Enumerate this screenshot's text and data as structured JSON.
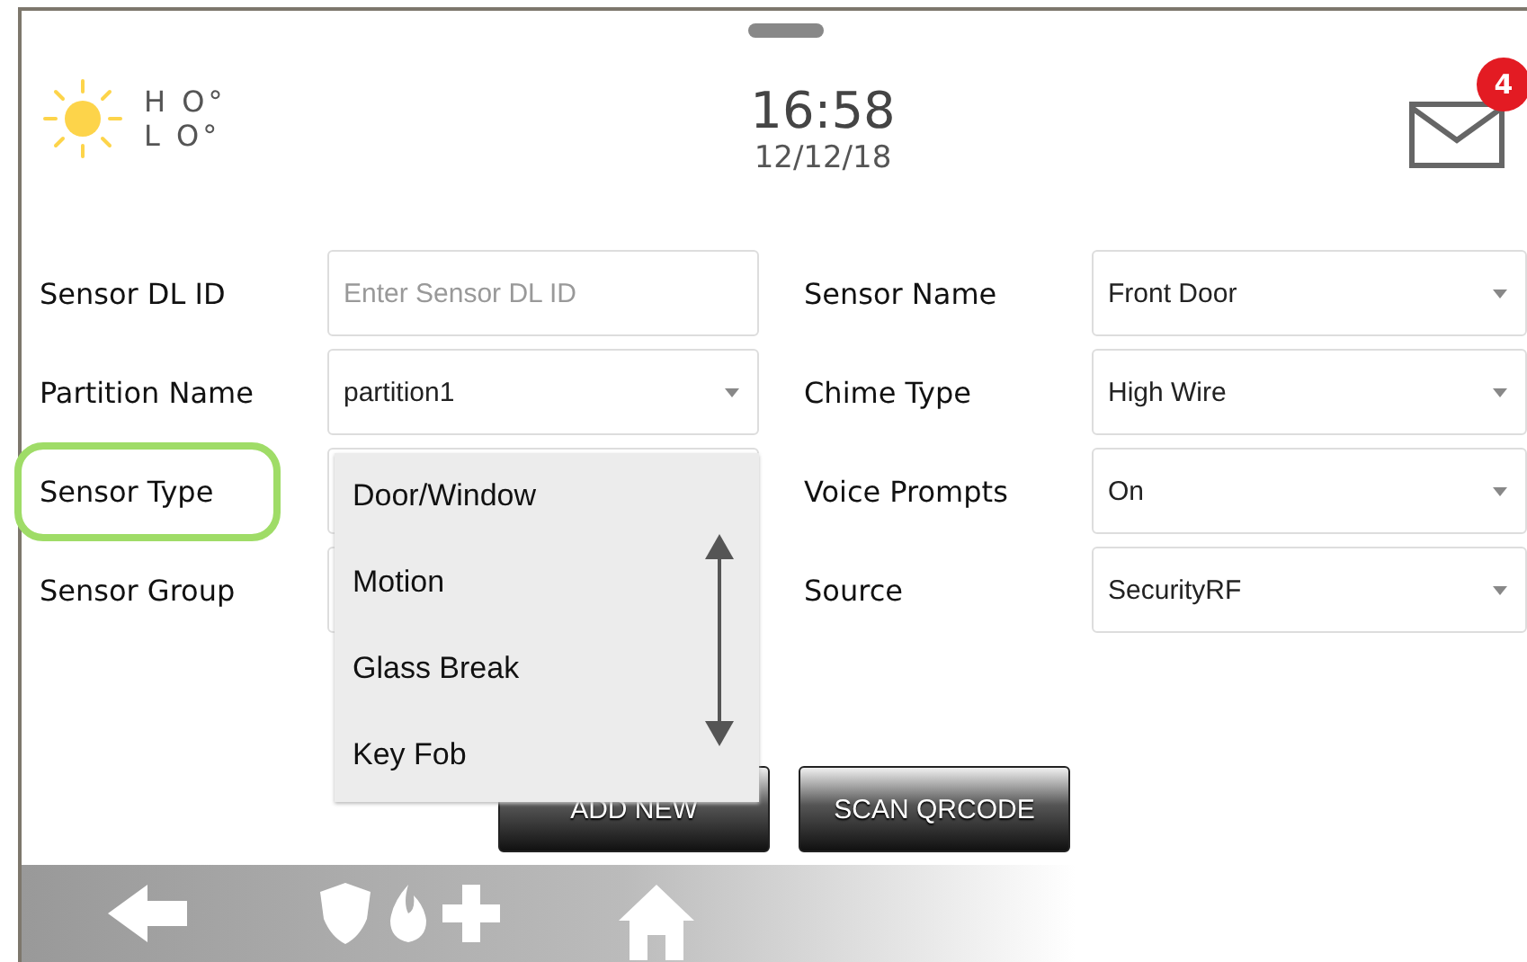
{
  "weather": {
    "high": "H O°",
    "low": "L O°"
  },
  "clock": {
    "time": "16:58",
    "date": "12/12/18"
  },
  "messages": {
    "count": "4"
  },
  "form_left": [
    {
      "label": "Sensor DL ID",
      "kind": "text",
      "placeholder": "Enter Sensor DL ID",
      "highlighted": false
    },
    {
      "label": "Partition Name",
      "kind": "select",
      "value": "partition1",
      "highlighted": false
    },
    {
      "label": "Sensor Type",
      "kind": "select",
      "highlighted": true
    },
    {
      "label": "Sensor Group",
      "kind": "select",
      "highlighted": false
    }
  ],
  "form_right": [
    {
      "label": "Sensor Name",
      "kind": "select",
      "value": "Front Door"
    },
    {
      "label": "Chime Type",
      "kind": "select",
      "value": "High Wire"
    },
    {
      "label": "Voice Prompts",
      "kind": "select",
      "value": "On"
    },
    {
      "label": "Source",
      "kind": "select",
      "value": "SecurityRF"
    }
  ],
  "dropdown": {
    "options": [
      "Door/Window",
      "Motion",
      "Glass Break",
      "Key Fob"
    ]
  },
  "buttons": [
    "ADD NEW",
    "SCAN QRCODE"
  ]
}
